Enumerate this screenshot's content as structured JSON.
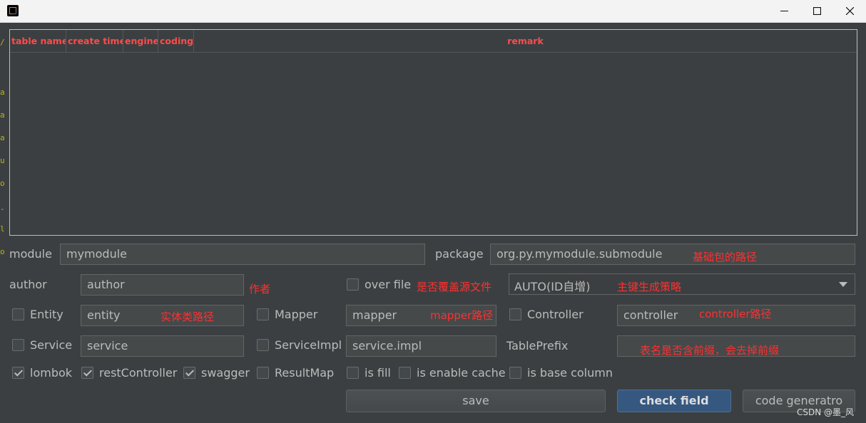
{
  "window": {
    "icon": "intellij-icon",
    "controls": {
      "minimize": "minimize-icon",
      "maximize": "maximize-icon",
      "close": "close-icon"
    }
  },
  "left_strip_chars": [
    "/",
    "a",
    "a",
    "a",
    "u",
    "o",
    "-",
    "l",
    "o"
  ],
  "table": {
    "columns": [
      "table name",
      "create time",
      "engine",
      "coding",
      "remark"
    ],
    "rows": []
  },
  "form": {
    "module": {
      "label": "module",
      "value": "mymodule"
    },
    "package": {
      "label": "package",
      "value": "org.py.mymodule.submodule",
      "note": "基础包的路径"
    },
    "author": {
      "label": "author",
      "value": "author",
      "note": "作者"
    },
    "over_file": {
      "label": "over file",
      "checked": false,
      "note": "是否覆盖源文件"
    },
    "id_strategy": {
      "value": "AUTO(ID自增)",
      "note": "主键生成策略"
    },
    "entity": {
      "label": "Entity",
      "checked": false,
      "value": "entity",
      "note": "实体类路径"
    },
    "mapper": {
      "label": "Mapper",
      "checked": false,
      "value": "mapper",
      "note": "mapper路径"
    },
    "controller": {
      "label": "Controller",
      "checked": false,
      "value": "controller",
      "note": "controller路径"
    },
    "service": {
      "label": "Service",
      "checked": false,
      "value": "service"
    },
    "service_impl": {
      "label": "ServiceImpl",
      "checked": false,
      "value": "service.impl"
    },
    "table_prefix": {
      "label": "TablePrefix",
      "value": "",
      "note": "表名是否含前缀，会去掉前缀"
    },
    "options": [
      {
        "label": "lombok",
        "checked": true
      },
      {
        "label": "restController",
        "checked": true
      },
      {
        "label": "swagger",
        "checked": true
      },
      {
        "label": "ResultMap",
        "checked": false
      },
      {
        "label": "is fill",
        "checked": false
      },
      {
        "label": "is enable cache",
        "checked": false
      },
      {
        "label": "is base column",
        "checked": false
      }
    ]
  },
  "buttons": {
    "save": "save",
    "check_field": "check field",
    "code_generator": "code generatro"
  },
  "watermark": "CSDN @墨_风"
}
